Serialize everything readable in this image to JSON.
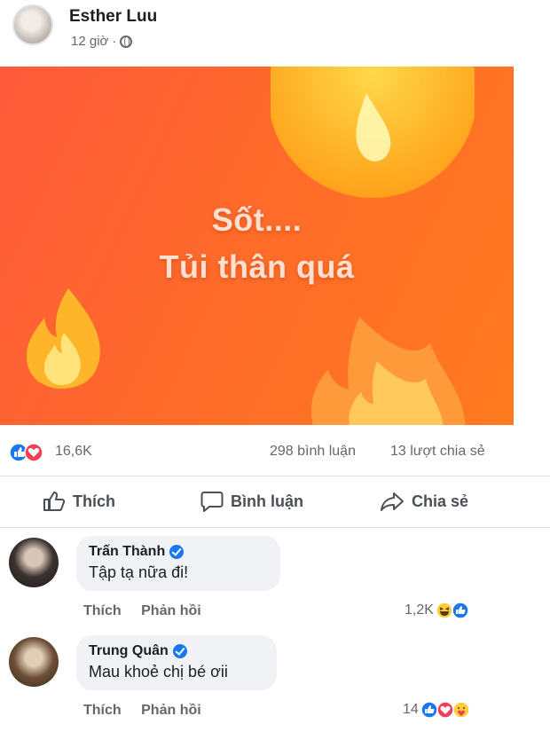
{
  "post": {
    "author": "Esther Luu",
    "time": "12 giờ",
    "separator": "·",
    "banner_line1": "Sốt....",
    "banner_line2": "Tủi thân quá",
    "reactions": {
      "count": "16,6K",
      "icons": [
        "like-icon",
        "love-icon"
      ],
      "colors": {
        "like": "#1877f2",
        "love": "#f33e58"
      }
    },
    "comments_count": "298 bình luận",
    "shares_count": "13 lượt chia sẻ"
  },
  "actions": {
    "like": "Thích",
    "comment": "Bình luận",
    "share": "Chia sẻ"
  },
  "comments": [
    {
      "name": "Trấn Thành",
      "text": "Tập tạ nữa đi!",
      "like_label": "Thích",
      "reply_label": "Phản hồi",
      "reaction_count": "1,2K",
      "reaction_icons": [
        "haha-icon",
        "like-icon"
      ]
    },
    {
      "name": "Trung Quân",
      "text": "Mau khoẻ chị bé ơii",
      "like_label": "Thích",
      "reply_label": "Phản hồi",
      "reaction_count": "14",
      "reaction_icons": [
        "like-icon",
        "love-icon",
        "care-icon"
      ]
    }
  ],
  "colors": {
    "banner": "#ff6a2a",
    "verified": "#1877f2",
    "bubble": "#f0f2f5"
  }
}
